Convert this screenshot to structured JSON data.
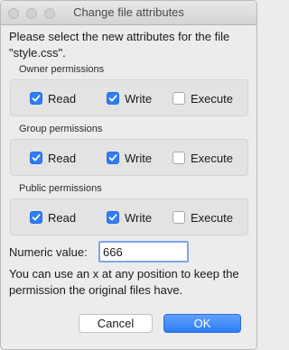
{
  "window": {
    "title": "Change file attributes"
  },
  "intro_text": "Please select the new attributes for the file \"style.css\".",
  "owner": {
    "label": "Owner permissions",
    "read": {
      "label": "Read",
      "checked": true
    },
    "write": {
      "label": "Write",
      "checked": true
    },
    "execute": {
      "label": "Execute",
      "checked": false
    }
  },
  "group": {
    "label": "Group permissions",
    "read": {
      "label": "Read",
      "checked": true
    },
    "write": {
      "label": "Write",
      "checked": true
    },
    "execute": {
      "label": "Execute",
      "checked": false
    }
  },
  "public": {
    "label": "Public permissions",
    "read": {
      "label": "Read",
      "checked": true
    },
    "write": {
      "label": "Write",
      "checked": true
    },
    "execute": {
      "label": "Execute",
      "checked": false
    }
  },
  "numeric": {
    "label": "Numeric value:",
    "value": "666"
  },
  "hint_text": "You can use an x at any position to keep the permission the original files have.",
  "buttons": {
    "cancel": "Cancel",
    "ok": "OK"
  },
  "colors": {
    "accent": "#2f7cf6",
    "background": "#ececec"
  }
}
